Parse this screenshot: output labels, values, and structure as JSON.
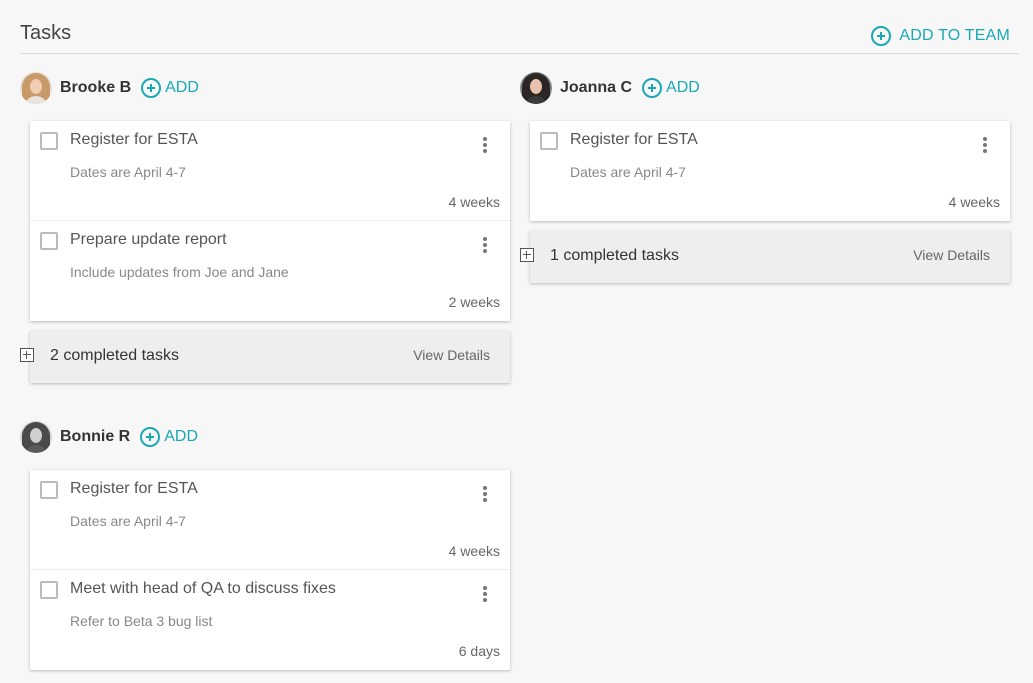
{
  "header": {
    "title": "Tasks",
    "add_to_team": "ADD TO TEAM"
  },
  "add_label": "ADD",
  "accent": "#1aa8b5",
  "people": [
    {
      "name": "Brooke B",
      "tasks": [
        {
          "title": "Register for ESTA",
          "desc": "Dates are April 4-7",
          "due": "4 weeks"
        },
        {
          "title": "Prepare update report",
          "desc": "Include updates from Joe and Jane",
          "due": "2 weeks"
        }
      ],
      "completed": "2 completed tasks",
      "view": "View Details"
    },
    {
      "name": "Joanna C",
      "tasks": [
        {
          "title": "Register for ESTA",
          "desc": "Dates are April 4-7",
          "due": "4 weeks"
        }
      ],
      "completed": "1 completed tasks",
      "view": "View Details"
    },
    {
      "name": "Bonnie R",
      "tasks": [
        {
          "title": "Register for ESTA",
          "desc": "Dates are April 4-7",
          "due": "4 weeks"
        },
        {
          "title": "Meet with head of QA to discuss fixes",
          "desc": "Refer to Beta 3 bug list",
          "due": "6 days"
        }
      ]
    }
  ]
}
